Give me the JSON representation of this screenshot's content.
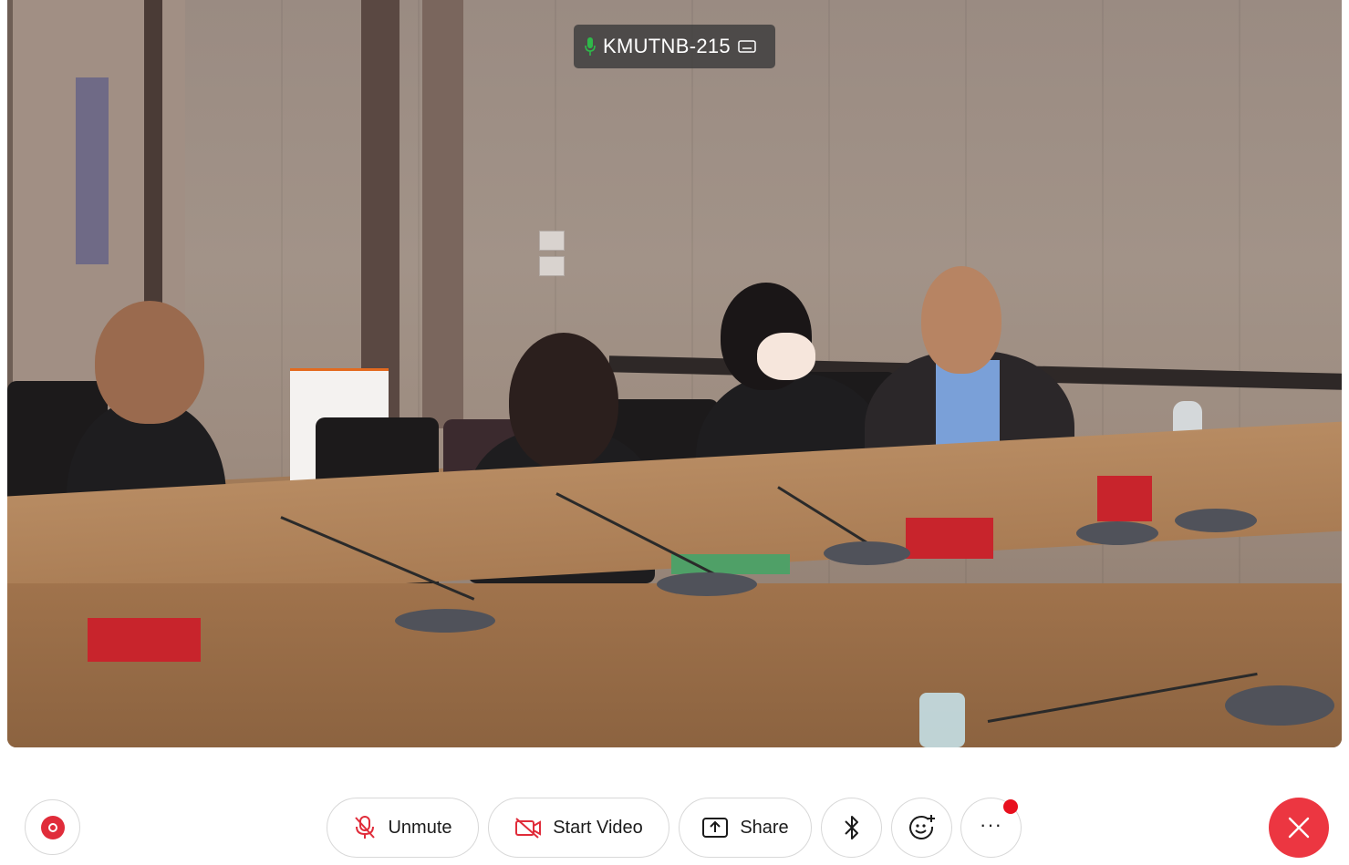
{
  "participant": {
    "name": "KMUTNB-215",
    "mic_icon": "mic-active-icon",
    "caption_icon": "closed-caption-icon"
  },
  "controls": {
    "record_icon": "record-icon",
    "unmute_label": "Unmute",
    "unmute_icon": "mic-muted-icon",
    "start_video_label": "Start Video",
    "start_video_icon": "video-off-icon",
    "share_label": "Share",
    "share_icon": "share-screen-icon",
    "bluetooth_icon": "bluetooth-icon",
    "reactions_icon": "emoji-add-icon",
    "more_label": "···",
    "more_badge": "notification-dot",
    "end_icon": "close-icon"
  },
  "colors": {
    "accent_red": "#ec3641",
    "mic_active_green": "#2fb84a",
    "muted_red": "#e02c3a",
    "badge_red": "#e8101e"
  }
}
